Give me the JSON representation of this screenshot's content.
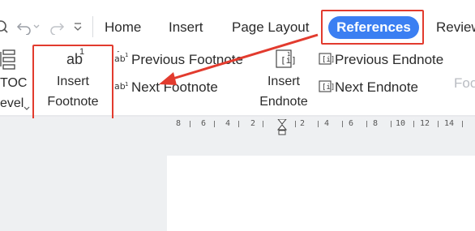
{
  "colors": {
    "accent": "#3b7ff2",
    "highlight": "#e23b2e"
  },
  "quick_access": {
    "icons": [
      "undo-icon",
      "redo-icon",
      "customize-icon"
    ]
  },
  "tabs": [
    {
      "label": "Home"
    },
    {
      "label": "Insert"
    },
    {
      "label": "Page Layout"
    },
    {
      "label": "References",
      "active": true
    },
    {
      "label": "Review"
    }
  ],
  "ribbon": {
    "toc": {
      "label_line1": "TOC",
      "label_line2": "evel"
    },
    "insert_footnote": {
      "icon_text": "ab",
      "superscript": "1",
      "label_line1": "Insert",
      "label_line2": "Footnote"
    },
    "previous_footnote": {
      "label": "Previous Footnote"
    },
    "next_footnote": {
      "label": "Next Footnote"
    },
    "insert_endnote": {
      "label_line1": "Insert",
      "label_line2": "Endnote"
    },
    "previous_endnote": {
      "label": "Previous Endnote"
    },
    "next_endnote": {
      "label": "Next Endnote"
    },
    "cut_off": {
      "label": "Foo"
    }
  },
  "ruler": {
    "ticks": [
      "8",
      "6",
      "4",
      "2",
      "2",
      "4",
      "6",
      "8",
      "10",
      "12",
      "14"
    ]
  }
}
